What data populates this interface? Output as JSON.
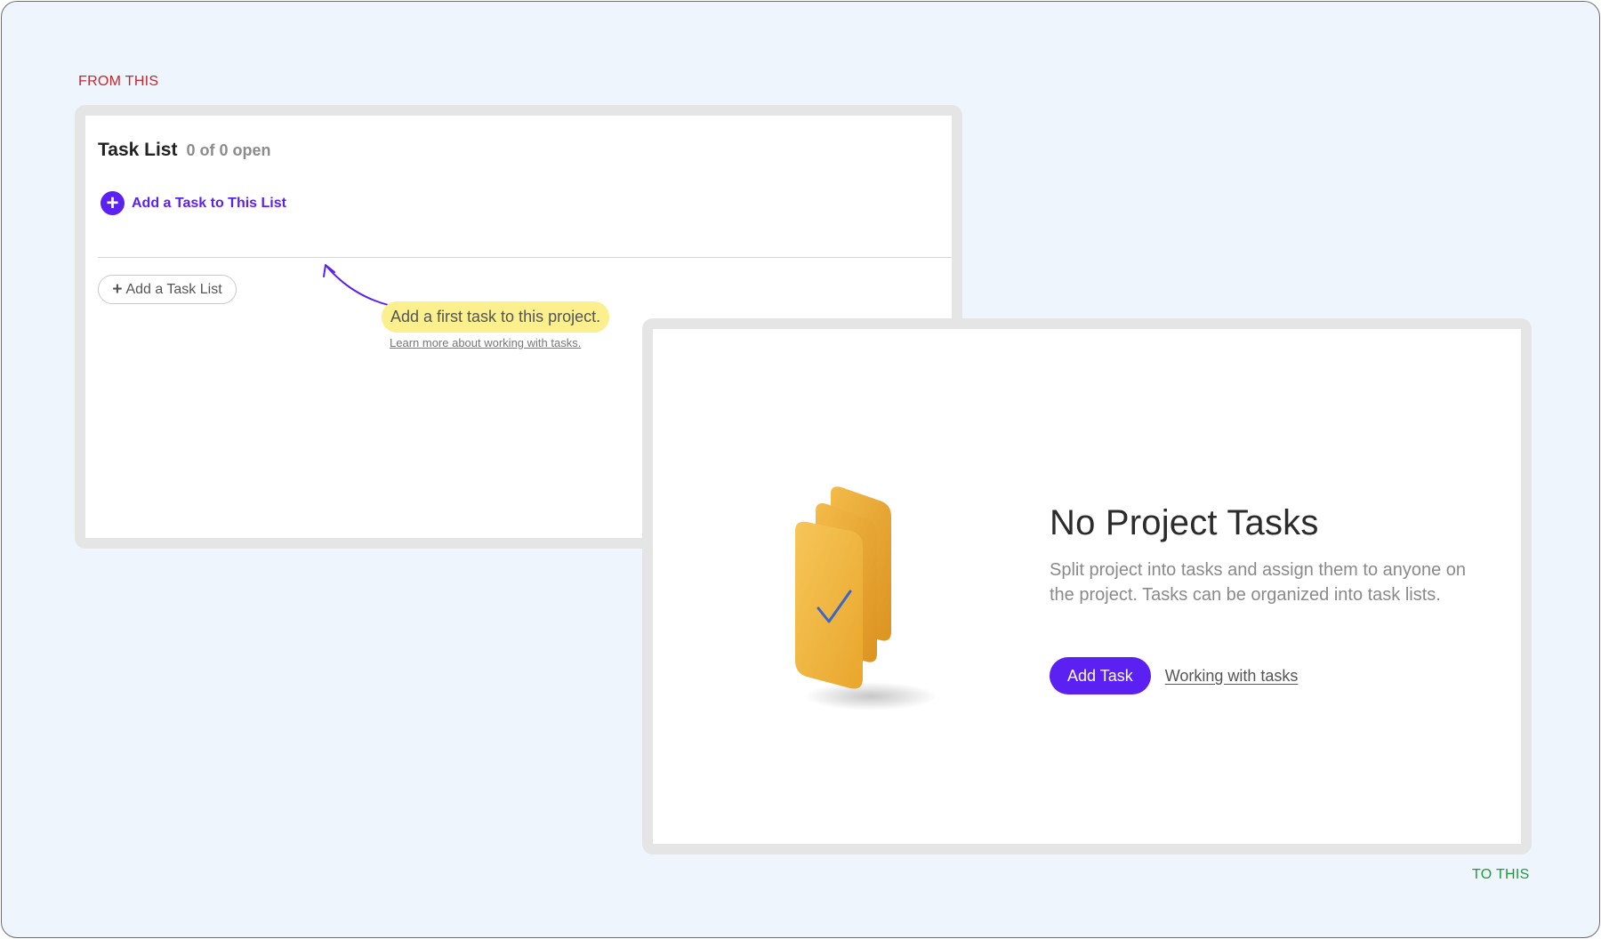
{
  "captions": {
    "from": "FROM THIS",
    "to": "TO THIS"
  },
  "old_ui": {
    "title": "Task List",
    "count": "0 of 0 open",
    "add_task_label": "Add a Task to This List",
    "add_task_icon": "plus-circle-icon",
    "add_list_label": "Add a Task List",
    "hint_text": "Add a first task to this project.",
    "hint_link": "Learn more about working with tasks.",
    "accent_color": "#5b21f2",
    "hint_bg_color": "#fbef8e"
  },
  "new_ui": {
    "title": "No Project Tasks",
    "description": "Split project into tasks and assign them to anyone on the project. Tasks can be organized into task lists.",
    "primary_button": "Add Task",
    "secondary_link": "Working with tasks",
    "illustration": "stacked-task-cards-checkmark-icon",
    "accent_color": "#5b21f2"
  },
  "colors": {
    "background": "#eff5fd",
    "from_caption": "#c4262e",
    "to_caption": "#1f9b3b"
  }
}
